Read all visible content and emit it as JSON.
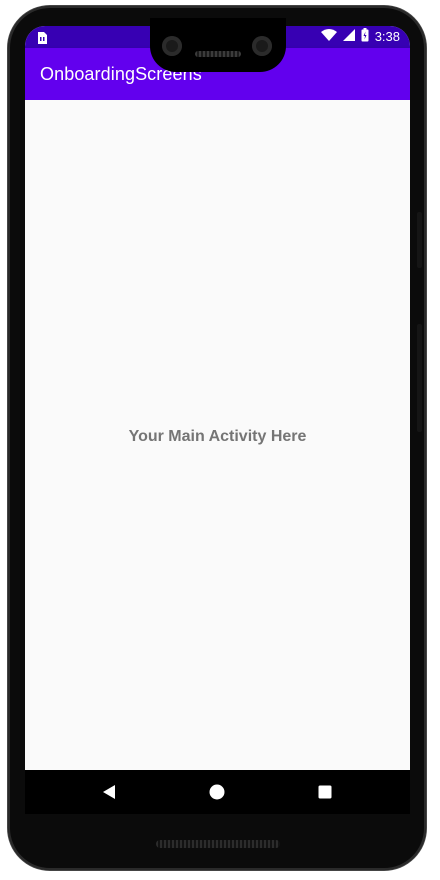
{
  "status_bar": {
    "time": "3:38",
    "icons": [
      "sim-card-icon",
      "wifi-icon",
      "signal-icon",
      "battery-icon"
    ]
  },
  "app_bar": {
    "title": "OnboardingScreens",
    "color": "#6200ee",
    "status_color": "#3700b3"
  },
  "main": {
    "text": "Your Main Activity Here",
    "text_color": "#757575",
    "background": "#fafafa"
  },
  "nav_bar": {
    "buttons": [
      "back-icon",
      "home-icon",
      "recents-icon"
    ]
  }
}
